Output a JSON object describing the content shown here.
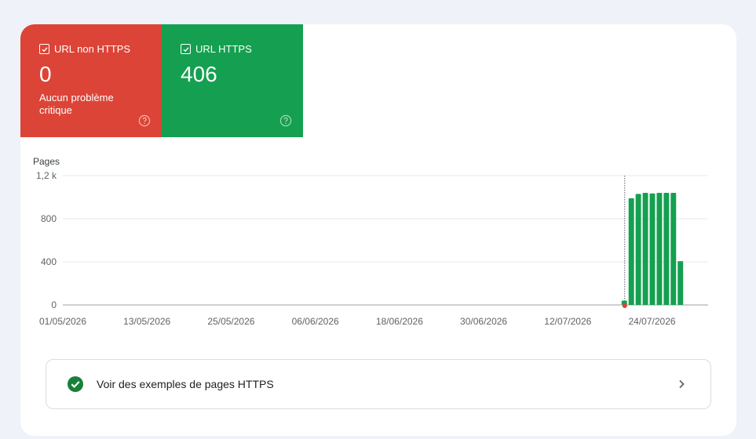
{
  "tiles": {
    "non_https": {
      "label": "URL non HTTPS",
      "value": "0",
      "subtitle": "Aucun problème critique",
      "color": "#dc4437",
      "icons": [
        "checkbox-checked-icon",
        "help-circle-icon"
      ]
    },
    "https": {
      "label": "URL HTTPS",
      "value": "406",
      "color": "#14a050",
      "icons": [
        "checkbox-checked-icon",
        "help-circle-icon"
      ]
    }
  },
  "chart_data": {
    "type": "bar",
    "title": "",
    "ylabel": "Pages",
    "ylim": [
      0,
      1200
    ],
    "yticks": [
      0,
      400,
      800,
      1200
    ],
    "yticklabels": [
      "0",
      "400",
      "800",
      "1,2 k"
    ],
    "xlim": [
      "2026-05-01",
      "2026-08-01"
    ],
    "xticklabels": [
      "01/05/2026",
      "13/05/2026",
      "25/05/2026",
      "06/06/2026",
      "18/06/2026",
      "30/06/2026",
      "12/07/2026",
      "24/07/2026"
    ],
    "grid": true,
    "marker": {
      "date": "2026-07-20",
      "color": "#dc4437",
      "style": "dotted line"
    },
    "series": [
      {
        "name": "URL HTTPS",
        "color": "#14a050",
        "x": [
          "2026-07-20",
          "2026-07-21",
          "2026-07-22",
          "2026-07-23",
          "2026-07-24",
          "2026-07-25",
          "2026-07-26",
          "2026-07-27",
          "2026-07-28"
        ],
        "values": [
          40,
          990,
          1030,
          1040,
          1035,
          1040,
          1040,
          1040,
          406
        ]
      }
    ]
  },
  "examples_link": {
    "label": "Voir des exemples de pages HTTPS",
    "status_icon": "check-circle-icon",
    "status_color": "#188038",
    "arrow_icon": "chevron-right-icon"
  }
}
